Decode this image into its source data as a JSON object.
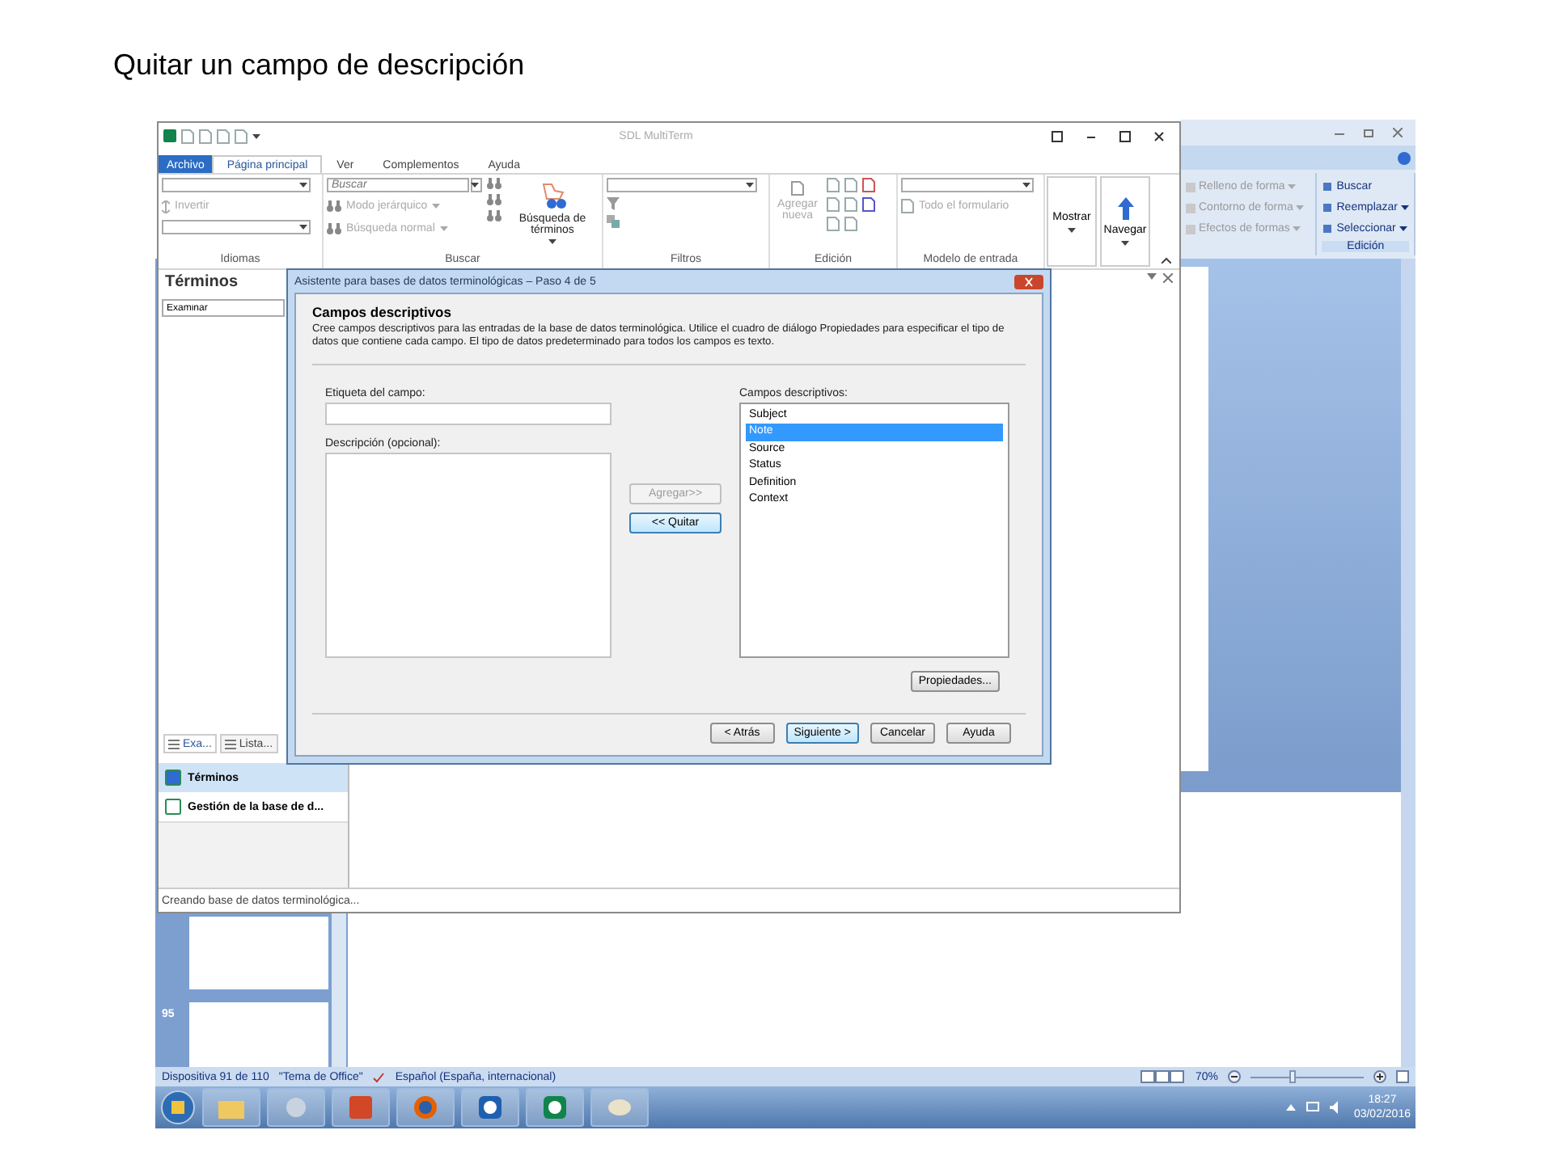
{
  "slide_title": "Quitar un campo de descripción",
  "powerpoint": {
    "drawing_items": [
      {
        "label": "Relleno de forma"
      },
      {
        "label": "Contorno de forma"
      },
      {
        "label": "Efectos de formas"
      }
    ],
    "edit_group": {
      "label": "Edición",
      "items": [
        {
          "label": "Buscar",
          "dropdown": false
        },
        {
          "label": "Reemplazar",
          "dropdown": true
        },
        {
          "label": "Seleccionar",
          "dropdown": true
        }
      ]
    },
    "thumbnails": [
      {
        "number": "95"
      }
    ],
    "status_bar": {
      "slide": "Dispositiva 91 de 110",
      "theme": "\"Tema de Office\"",
      "language": "Español (España, internacional)",
      "zoom": "70%",
      "level": 0.36
    },
    "clock": {
      "time": "18:27",
      "date": "03/02/2016"
    }
  },
  "multiterm": {
    "title": "SDL MultiTerm",
    "tabs": [
      {
        "label": "Archivo",
        "kind": "file",
        "selected": false
      },
      {
        "label": "Página principal",
        "kind": "tab",
        "selected": true
      },
      {
        "label": "Ver",
        "kind": "tab",
        "selected": false
      },
      {
        "label": "Complementos",
        "kind": "tab",
        "selected": false
      },
      {
        "label": "Ayuda",
        "kind": "tab",
        "selected": false
      }
    ],
    "idiomas": {
      "label": "Idiomas",
      "invert": {
        "label": "Invertir",
        "disabled": true
      }
    },
    "buscar": {
      "label": "Buscar",
      "placeholder": "Buscar",
      "mode": {
        "label": "Modo jerárquico",
        "disabled": true
      },
      "search_type": {
        "label": "Búsqueda normal",
        "disabled": true
      },
      "big_button": "Búsqueda de términos"
    },
    "filtros": {
      "label": "Filtros"
    },
    "edicion": {
      "label": "Edición",
      "add": {
        "label": "Agregar nueva",
        "disabled": true
      }
    },
    "modelo": {
      "label": "Modelo de entrada",
      "whole_form": {
        "label": "Todo el formulario",
        "disabled": true
      }
    },
    "show": "Mostrar",
    "navigate": "Navegar",
    "panel": {
      "title": "Términos",
      "field": "Examinar",
      "tabs": [
        {
          "label": "Exa...",
          "selected": true
        },
        {
          "label": "Lista...",
          "selected": false
        }
      ],
      "nav": [
        {
          "label": "Términos",
          "selected": true
        },
        {
          "label": "Gestión de la base de d...",
          "selected": false
        }
      ]
    },
    "status": "Creando base de datos terminológica..."
  },
  "dialog": {
    "title": "Asistente para bases de datos terminológicas – Paso 4 de 5",
    "heading": "Campos descriptivos",
    "description": "Cree campos descriptivos para las entradas de la base de datos terminológica. Utilice el cuadro de diálogo Propiedades para especificar el tipo de datos que contiene cada campo. El tipo de datos predeterminado para todos los campos es texto.",
    "label_field": "Etiqueta del campo:",
    "description_field": "Descripción (opcional):",
    "add_button": {
      "label": "Agregar>>",
      "disabled": true
    },
    "remove_button": {
      "label": "<< Quitar",
      "disabled": false
    },
    "list_label": "Campos descriptivos:",
    "fields": [
      {
        "label": "Subject",
        "selected": false
      },
      {
        "label": "Note",
        "selected": true
      },
      {
        "label": "Source",
        "selected": false
      },
      {
        "label": "Status",
        "selected": false
      },
      {
        "label": "Definition",
        "selected": false
      },
      {
        "label": "Context",
        "selected": false
      }
    ],
    "properties_button": "Propiedades...",
    "buttons": [
      {
        "label": "< Atrás",
        "default": false
      },
      {
        "label": "Siguiente >",
        "default": true
      },
      {
        "label": "Cancelar",
        "default": false
      },
      {
        "label": "Ayuda",
        "default": false
      }
    ]
  }
}
